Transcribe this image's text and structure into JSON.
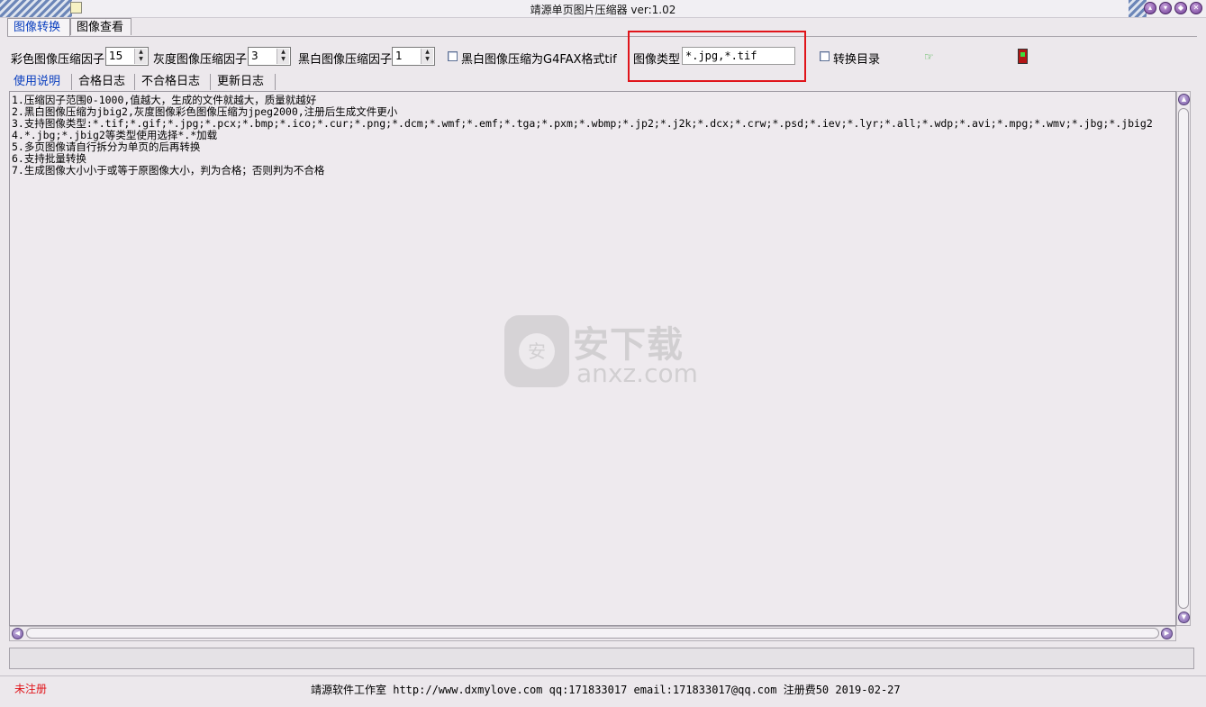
{
  "window": {
    "title": "靖源单页图片压缩器 ver:1.02"
  },
  "tabs": [
    "图像转换",
    "图像查看"
  ],
  "settings": {
    "color_label": "彩色图像压缩因子",
    "color_value": "15",
    "gray_label": "灰度图像压缩因子",
    "gray_value": "3",
    "bw_label": "黑白图像压缩因子",
    "bw_value": "1",
    "g4fax_label": "黑白图像压缩为G4FAX格式tif",
    "type_label": "图像类型",
    "type_value": "*.jpg,*.tif",
    "dir_label": "转换目录",
    "go_icon": "hand-pointer-icon",
    "exit_icon": "exit-door-icon"
  },
  "subtabs": [
    "使用说明",
    "合格日志",
    "不合格日志",
    "更新日志"
  ],
  "instructions": [
    "1.压缩因子范围0-1000,值越大，生成的文件就越大，质量就越好",
    "2.黑白图像压缩为jbig2,灰度图像彩色图像压缩为jpeg2000,注册后生成文件更小",
    "3.支持图像类型:*.tif;*.gif;*.jpg;*.pcx;*.bmp;*.ico;*.cur;*.png;*.dcm;*.wmf;*.emf;*.tga;*.pxm;*.wbmp;*.jp2;*.j2k;*.dcx;*.crw;*.psd;*.iev;*.lyr;*.all;*.wdp;*.avi;*.mpg;*.wmv;*.jbg;*.jbig2",
    "4.*.jbg;*.jbig2等类型使用选择*.*加载",
    "5.多页图像请自行拆分为单页的后再转换",
    "6.支持批量转换",
    "7.生成图像大小小于或等于原图像大小，判为合格；否则判为不合格"
  ],
  "watermark": {
    "shield_char": "安",
    "text_cn": "安下载",
    "text_en": "anxz.com"
  },
  "status": {
    "unregistered": "未注册",
    "info": "靖源软件工作室 http://www.dxmylove.com qq:171833017 email:171833017@qq.com 注册费50 2019-02-27"
  },
  "colors": {
    "highlight_box": "#e0141a",
    "active_tab": "#0a3fbf",
    "unregistered": "#e0141a"
  }
}
